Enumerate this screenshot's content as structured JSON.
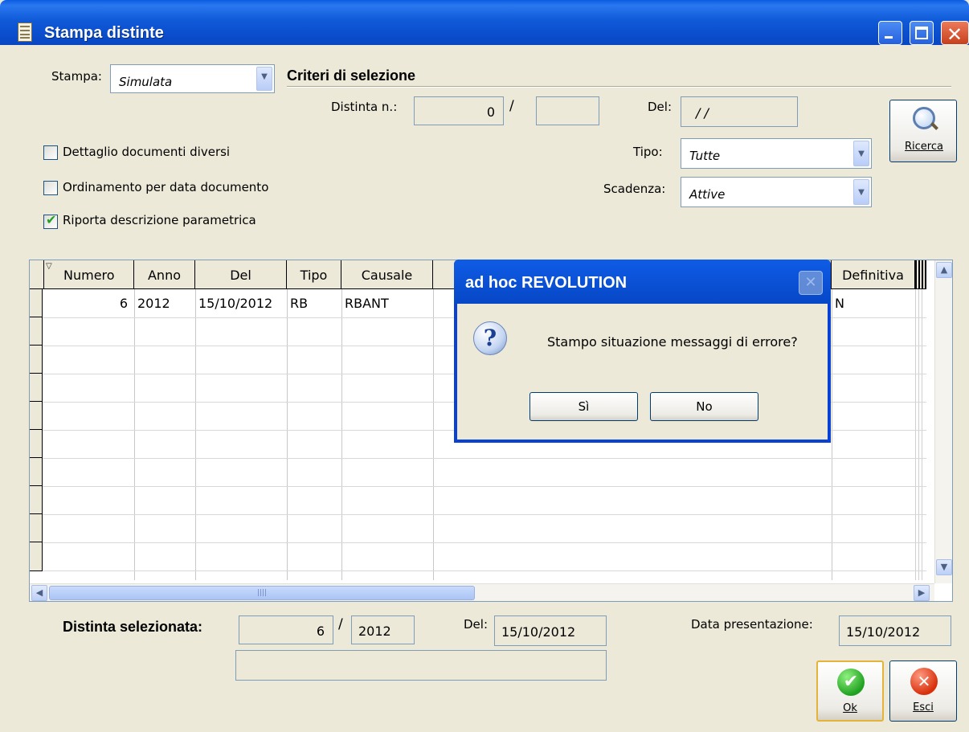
{
  "window": {
    "title": "Stampa distinte"
  },
  "form": {
    "stampa_label": "Stampa:",
    "stampa_value": "Simulata",
    "criteri_label": "Criteri di selezione",
    "distinta_label": "Distinta n.:",
    "distinta_num": "0",
    "distinta_sep": "/",
    "distinta_serie": "",
    "del_label": "Del:",
    "del_value": "/ /",
    "tipo_label": "Tipo:",
    "tipo_value": "Tutte",
    "scadenza_label": "Scadenza:",
    "scadenza_value": "Attive",
    "ricerca_label": "Ricerca",
    "checkboxes": [
      {
        "label": "Dettaglio documenti diversi",
        "checked": false
      },
      {
        "label": "Ordinamento per data documento",
        "checked": false
      },
      {
        "label": "Riporta descrizione parametrica",
        "checked": true
      }
    ]
  },
  "grid": {
    "columns": [
      "Numero",
      "Anno",
      "Del",
      "Tipo",
      "Causale",
      "Definitiva"
    ],
    "rows": [
      {
        "numero": "6",
        "anno": "2012",
        "del": "15/10/2012",
        "tipo": "RB",
        "causale": "RBANT",
        "definitiva": "N"
      }
    ]
  },
  "footer": {
    "selezionata_label": "Distinta selezionata:",
    "sel_num": "6",
    "sel_sep": "/",
    "sel_anno": "2012",
    "del_label": "Del:",
    "del_value": "15/10/2012",
    "presentazione_label": "Data presentazione:",
    "presentazione_value": "15/10/2012",
    "descrizione_value": "",
    "ok_label": "Ok",
    "esci_label": "Esci"
  },
  "dialog": {
    "title": "ad hoc REVOLUTION",
    "message": "Stampo situazione messaggi di errore?",
    "yes_label": "Sì",
    "no_label": "No"
  },
  "colors": {
    "titlebar": "#0a5be0",
    "window_bg": "#ece9d8",
    "field_border": "#7f9db9",
    "check": "#21a121"
  }
}
